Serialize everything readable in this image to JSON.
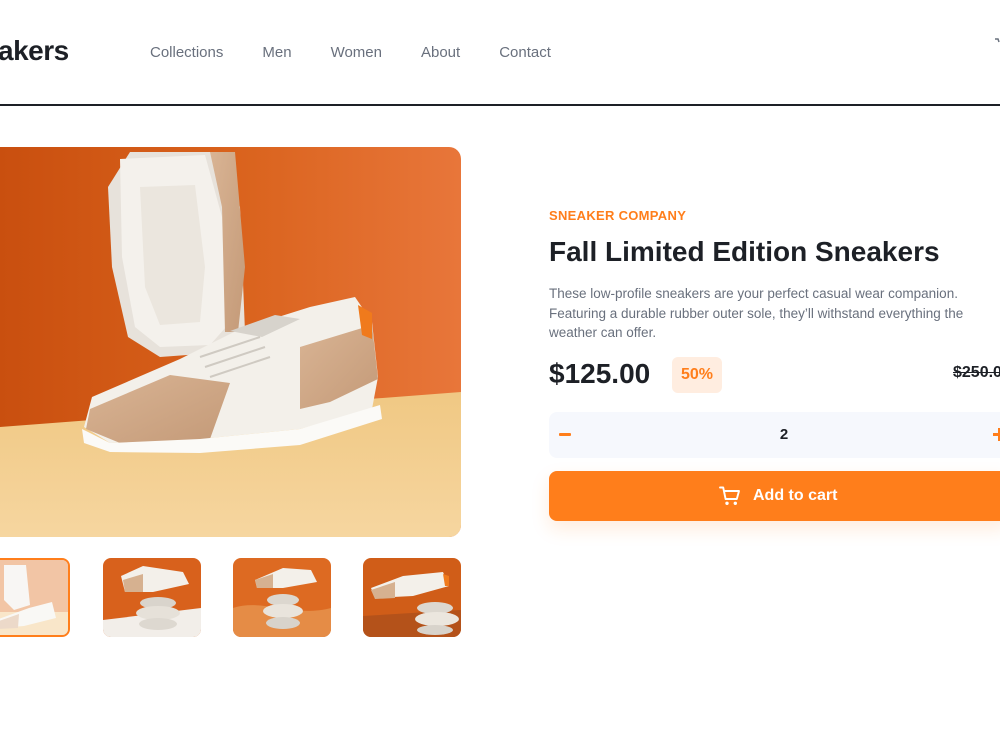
{
  "header": {
    "logo": "akers",
    "nav": [
      {
        "label": "Collections"
      },
      {
        "label": "Men"
      },
      {
        "label": "Women"
      },
      {
        "label": "About"
      },
      {
        "label": "Contact"
      }
    ],
    "icons": {
      "cart": "cart-icon"
    }
  },
  "gallery": {
    "thumbnail_count": 4,
    "active_thumbnail": 1
  },
  "product": {
    "company": "SNEAKER COMPANY",
    "title": "Fall Limited Edition Sneakers",
    "description": "These low-profile sneakers are your perfect casual wear companion. Featuring a durable rubber outer sole, they’ll withstand everything the weather can offer.",
    "price": "$125.00",
    "discount": "50%",
    "old_price": "$250.0"
  },
  "quantity": {
    "value": "2"
  },
  "add_to_cart": {
    "label": "Add to cart",
    "icon": "cart-icon"
  },
  "colors": {
    "accent": "#ff7e1b",
    "accent_pale": "#ffede0",
    "text_dark": "#1d2026",
    "text_gray": "#69707d",
    "qty_background": "#f6f8fd"
  }
}
